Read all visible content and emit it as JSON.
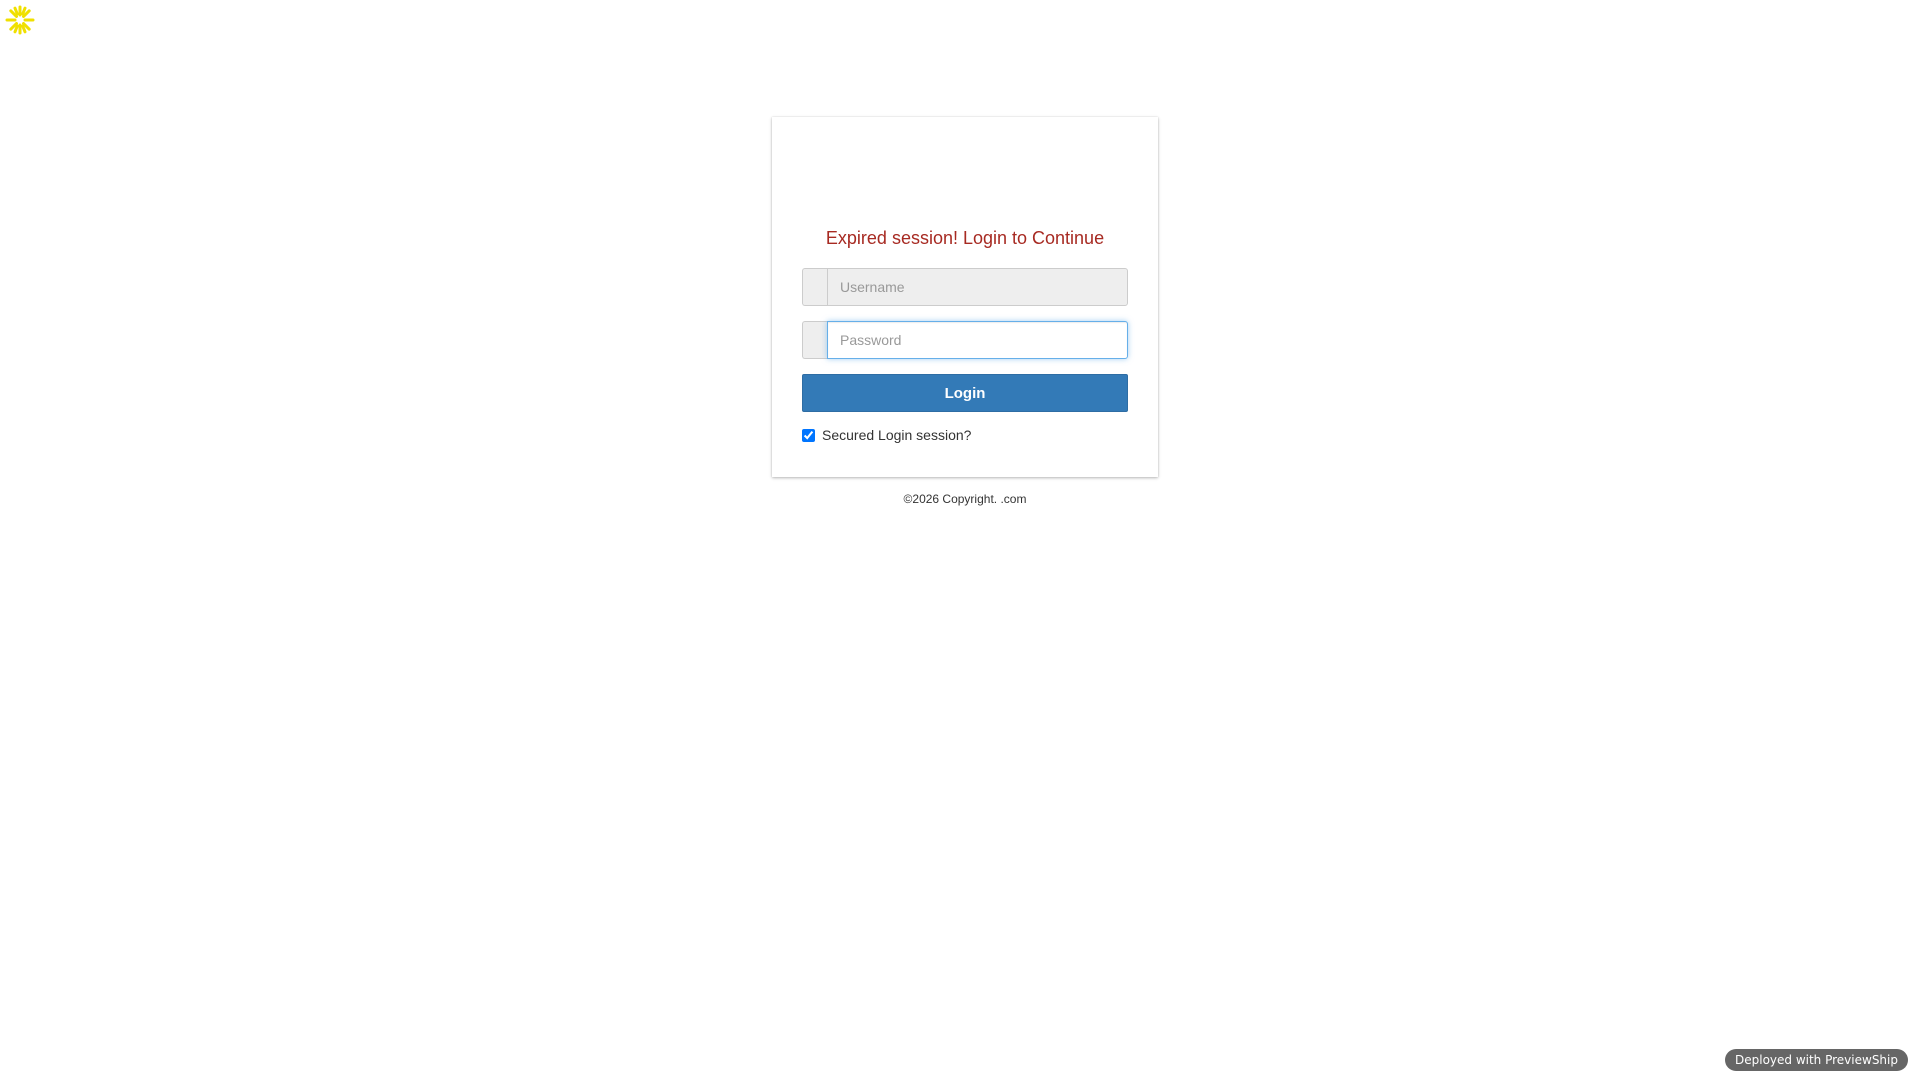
{
  "loader": {
    "icon": "spinner-icon",
    "color": "#f0e000"
  },
  "login": {
    "title": "Expired session! Login to Continue",
    "username_placeholder": "Username",
    "password_placeholder": "Password",
    "login_label": "Login",
    "remember_label": "Secured Login session?",
    "remember_checked": true
  },
  "footer": {
    "text": "©2026 Copyright. .com"
  },
  "badge": {
    "text": "Deployed with PreviewShip"
  },
  "colors": {
    "title": "#a72a22",
    "button": "#337ab7",
    "focus": "#66afe9"
  }
}
